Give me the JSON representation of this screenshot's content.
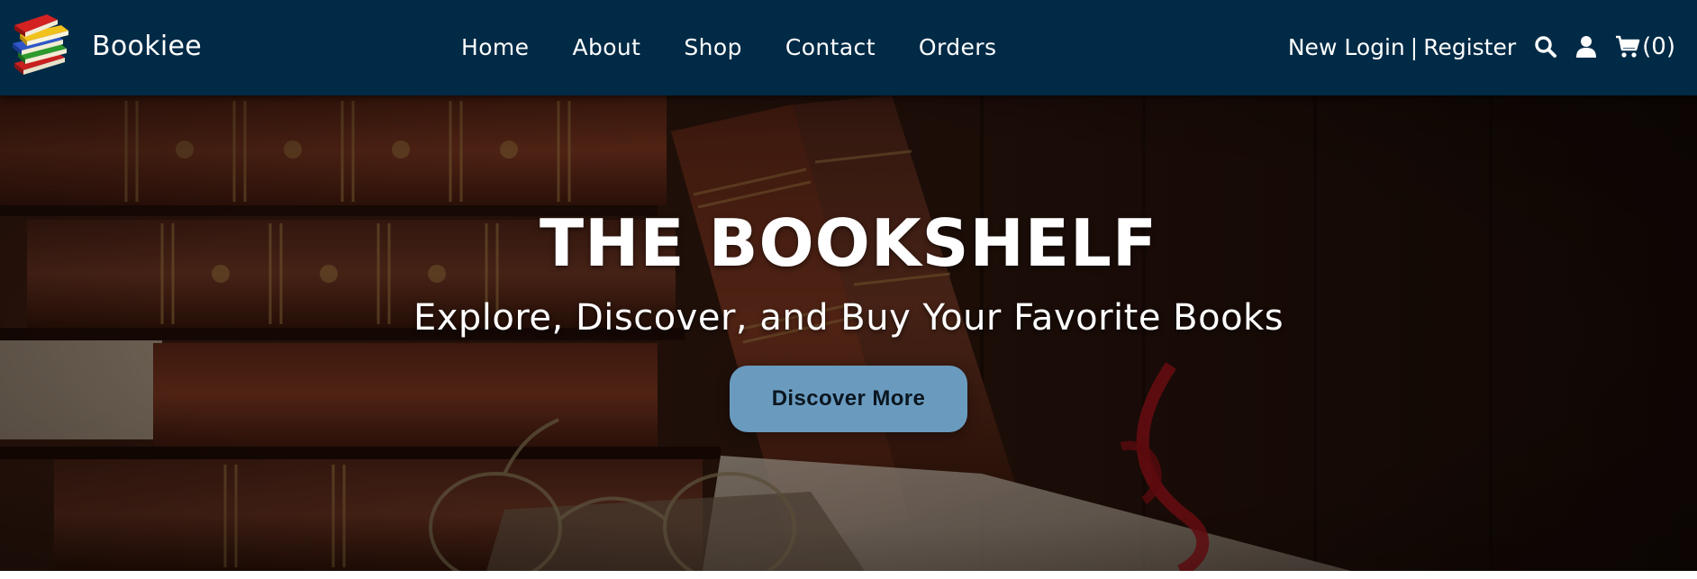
{
  "brand": {
    "name": "Bookiee",
    "logo_icon": "book-stack-icon"
  },
  "nav": {
    "links": [
      {
        "label": "Home"
      },
      {
        "label": "About"
      },
      {
        "label": "Shop"
      },
      {
        "label": "Contact"
      },
      {
        "label": "Orders"
      }
    ],
    "new_login_label": "New Login",
    "separator": "|",
    "register_label": "Register",
    "search_icon": "search-icon",
    "user_icon": "user-icon",
    "cart_icon": "cart-icon",
    "cart_count": "(0)"
  },
  "hero": {
    "title": "THE BOOKSHELF",
    "subtitle": "Explore, Discover, and Buy Your Favorite Books",
    "button_label": "Discover More",
    "background": "books-on-shelf-image"
  },
  "colors": {
    "navbar_bg": "#012a46",
    "button_bg": "#6a9bbf",
    "text": "#ffffff"
  }
}
